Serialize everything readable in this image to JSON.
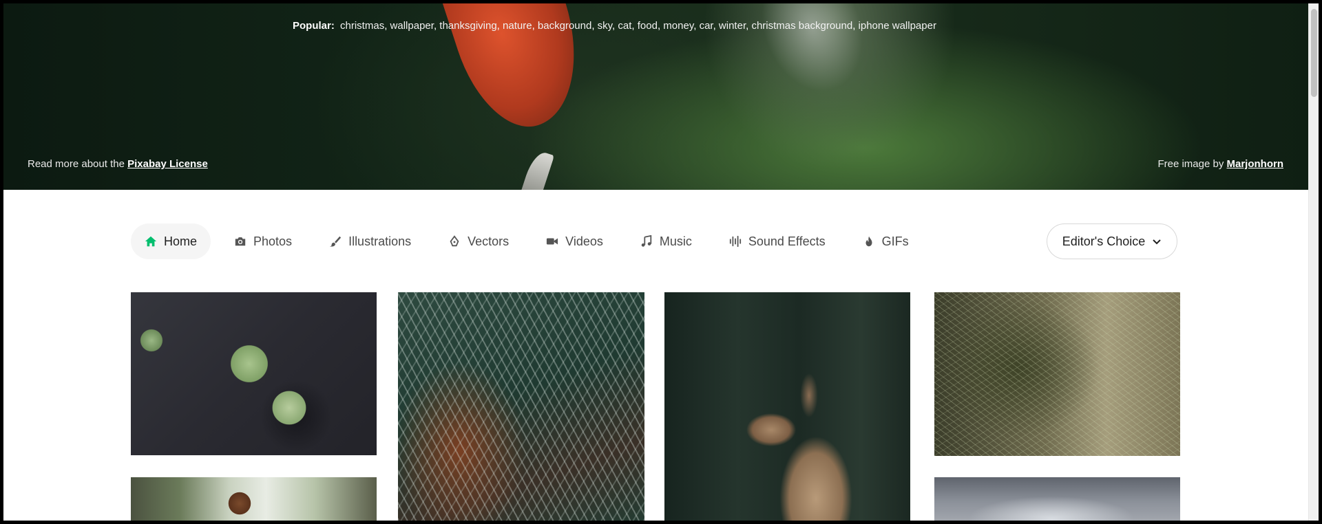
{
  "hero": {
    "popular_label": "Popular:",
    "popular_tags": [
      "christmas",
      "wallpaper",
      "thanksgiving",
      "nature",
      "background",
      "sky",
      "cat",
      "food",
      "money",
      "car",
      "winter",
      "christmas background",
      "iphone wallpaper"
    ],
    "license_text": "Read more about the",
    "license_link": "Pixabay License",
    "credit_text": "Free image by",
    "credit_author": "Marjonhorn"
  },
  "nav": {
    "items": [
      {
        "label": "Home",
        "icon": "home-icon",
        "active": true
      },
      {
        "label": "Photos",
        "icon": "camera-icon"
      },
      {
        "label": "Illustrations",
        "icon": "brush-icon"
      },
      {
        "label": "Vectors",
        "icon": "pen-nib-icon"
      },
      {
        "label": "Videos",
        "icon": "video-camera-icon"
      },
      {
        "label": "Music",
        "icon": "music-note-icon"
      },
      {
        "label": "Sound Effects",
        "icon": "sound-wave-icon"
      },
      {
        "label": "GIFs",
        "icon": "flame-icon"
      }
    ],
    "sort_label": "Editor's Choice",
    "accent_color": "#02be6e"
  },
  "grid": {
    "images": [
      "lily pads on dark water",
      "fir branch",
      "kangaroo",
      "pine needles",
      "child on stairs",
      "cloudy sky"
    ]
  }
}
